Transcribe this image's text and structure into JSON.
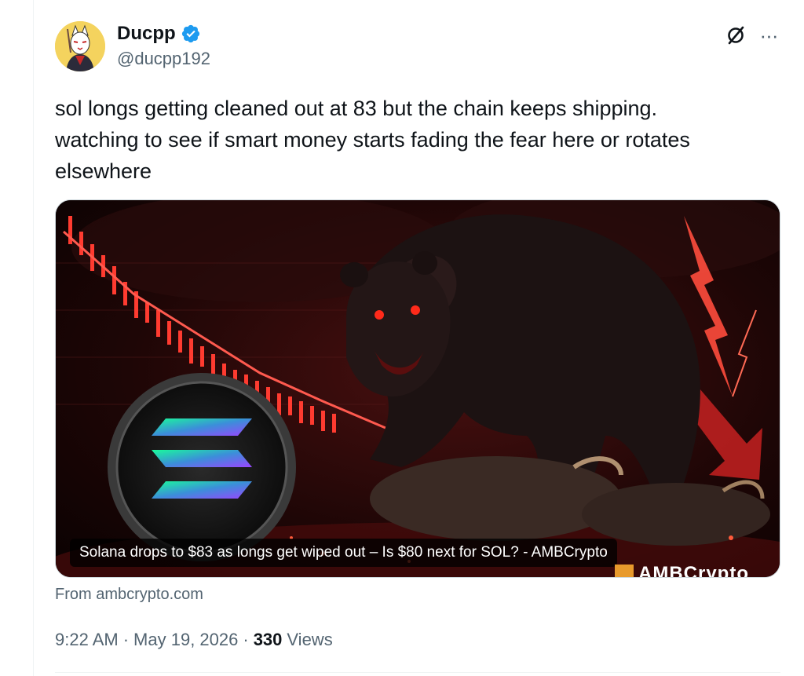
{
  "author": {
    "display_name": "Ducpp",
    "handle": "@ducpp192",
    "verified": true,
    "verified_color": "#1d9bf0",
    "avatar_icon": "cat-mask-avatar"
  },
  "header_actions": {
    "grok_icon": "grok-slash-icon",
    "more_icon": "more-horizontal-icon",
    "more_label": "···"
  },
  "tweet": {
    "text": "sol longs getting cleaned out at 83 but the chain keeps shipping. watching to see if smart money starts fading the fear here or rotates elsewhere"
  },
  "card": {
    "caption": "Solana drops to $83 as longs get wiped out – Is $80 next for SOL? - AMBCrypto",
    "watermark": "AMBCrypto",
    "source": "From ambcrypto.com",
    "accent_color": "#e53935"
  },
  "meta": {
    "time": "9:22 AM",
    "separator": "·",
    "date": "May 19, 2026",
    "views_count": "330",
    "views_label": "Views"
  }
}
